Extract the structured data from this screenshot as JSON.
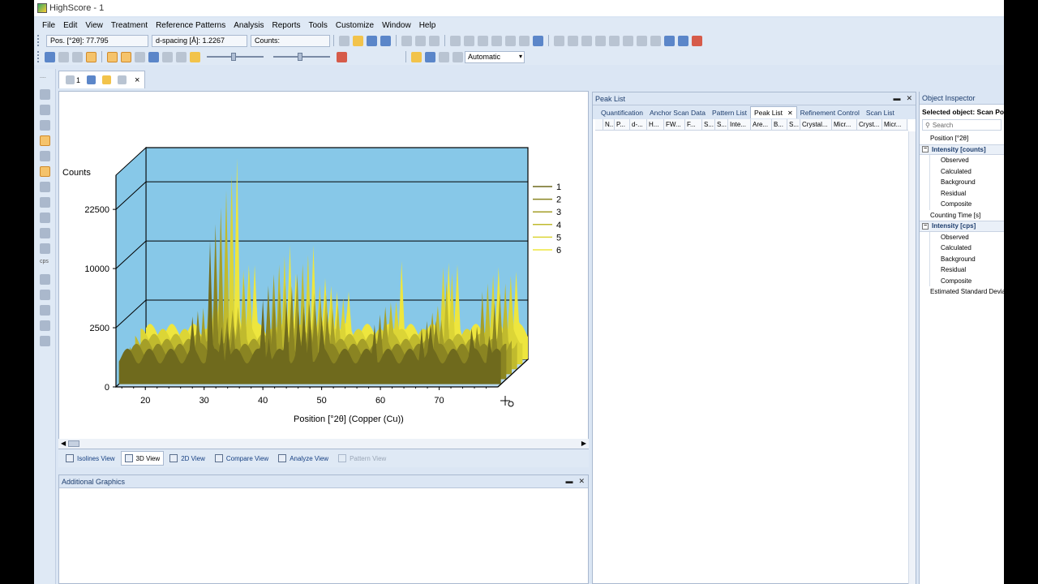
{
  "window": {
    "title": "HighScore - 1"
  },
  "menu": [
    "File",
    "Edit",
    "View",
    "Treatment",
    "Reference Patterns",
    "Analysis",
    "Reports",
    "Tools",
    "Customize",
    "Window",
    "Help"
  ],
  "toolbar": {
    "position_readout": "Pos. [°2θ]: 77.795",
    "dspacing_readout": "d-spacing [Å]: 1.2267",
    "counts_readout": "Counts:",
    "mode_select": "Automatic"
  },
  "document_tab": {
    "label": "1"
  },
  "chart_data": {
    "type": "area",
    "view": "3D",
    "ylabel": "Counts",
    "xlabel": "Position [°2θ] (Copper (Cu))",
    "y_ticks": [
      "22500",
      "10000",
      "2500",
      "0"
    ],
    "x_ticks": [
      "20",
      "30",
      "40",
      "50",
      "60",
      "70"
    ],
    "xlim": [
      15,
      80
    ],
    "y_scale": "square root",
    "series": [
      {
        "name": "1",
        "color": "#6f6a1d"
      },
      {
        "name": "2",
        "color": "#8a8422"
      },
      {
        "name": "3",
        "color": "#a59f28"
      },
      {
        "name": "4",
        "color": "#c0ba2e"
      },
      {
        "name": "5",
        "color": "#dcd536"
      },
      {
        "name": "6",
        "color": "#eee63e"
      }
    ],
    "peaks_2theta": [
      27.5,
      30.5,
      32.5,
      33.5,
      39.5,
      40.5,
      43.5,
      45.5,
      46.5,
      47.5,
      49.5,
      58.5,
      66.5,
      68.0,
      75.0,
      78.0
    ],
    "plot_background": "#87c8e8"
  },
  "view_tabs": [
    "Isolines View",
    "3D View",
    "2D View",
    "Compare View",
    "Analyze View",
    "Pattern View"
  ],
  "additional_graphics": {
    "title": "Additional Graphics"
  },
  "peak_list": {
    "title": "Peak List",
    "tabs": [
      "Quantification",
      "Anchor Scan Data",
      "Pattern List",
      "Peak List",
      "Refinement Control",
      "Scan List"
    ],
    "columns": [
      "N...",
      "P...",
      "d-...",
      "H...",
      "FW...",
      "F...",
      "S...",
      "S...",
      "Inte...",
      "Are...",
      "B...",
      "S...",
      "Crystal...",
      "Micr...",
      "Cryst...",
      "Micr..."
    ]
  },
  "object_inspector": {
    "title": "Object Inspector",
    "selected": "Selected object: Scan Po",
    "search_placeholder": "Search",
    "position": "Position [°2θ]",
    "group1": "Intensity [counts]",
    "group1_items": [
      "Observed",
      "Calculated",
      "Background",
      "Residual",
      "Composite"
    ],
    "counting_time": "Counting Time [s]",
    "group2": "Intensity [cps]",
    "group2_items": [
      "Observed",
      "Calculated",
      "Background",
      "Residual",
      "Composite"
    ],
    "esd": "Estimated Standard Devia"
  }
}
